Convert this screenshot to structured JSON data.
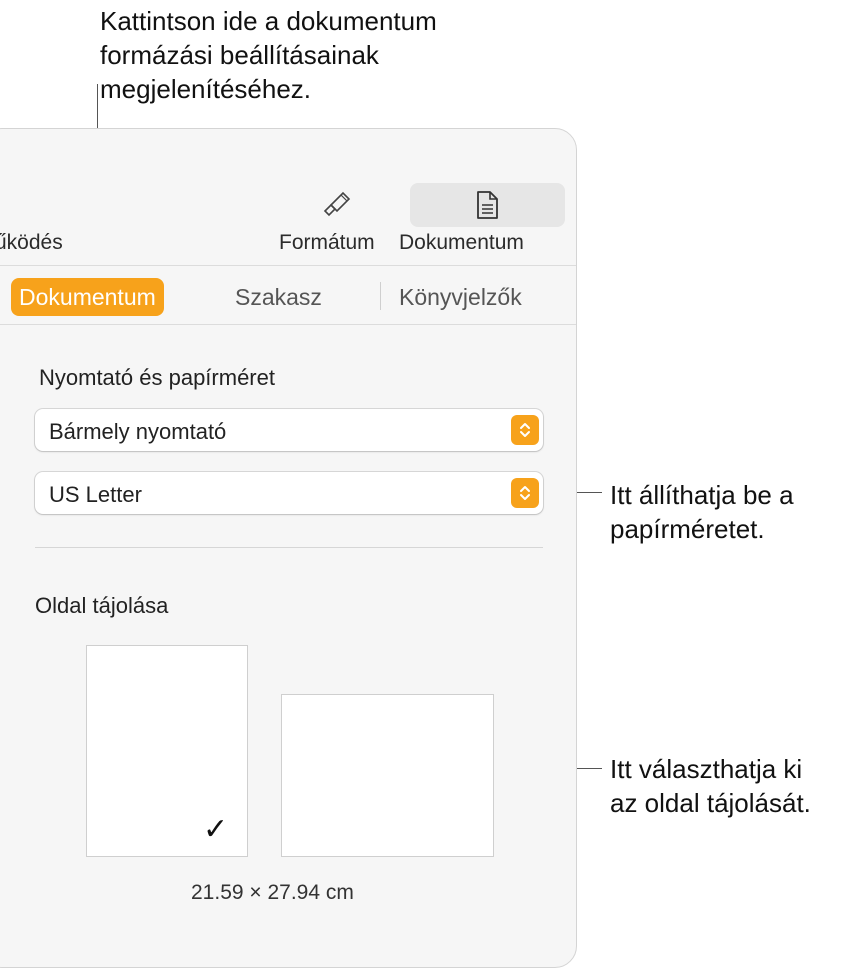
{
  "callouts": {
    "top": "Kattintson ide a dokumentum\nformázási beállításainak\nmegjelenítéséhez.",
    "paper_size": "Itt állíthatja be a\npapírméretet.",
    "orientation": "Itt választhatja ki\naz oldal tájolását."
  },
  "toolbar": {
    "partial_label": "űködés",
    "format_label": "Formátum",
    "format_icon": "paintbrush-icon",
    "document_label": "Dokumentum",
    "document_icon": "document-icon"
  },
  "tabs": [
    {
      "label": "Dokumentum",
      "active": true
    },
    {
      "label": "Szakasz",
      "active": false
    },
    {
      "label": "Könyvjelzők",
      "active": false
    }
  ],
  "printer_section": {
    "heading": "Nyomtató és papírméret",
    "printer_value": "Bármely nyomtató",
    "paper_value": "US Letter"
  },
  "orientation_section": {
    "heading": "Oldal tájolása",
    "portrait_selected": true,
    "checkmark": "✓",
    "dimensions": "21.59 × 27.94 cm"
  },
  "colors": {
    "accent": "#f7a21b",
    "panel_bg": "#f6f6f6"
  }
}
